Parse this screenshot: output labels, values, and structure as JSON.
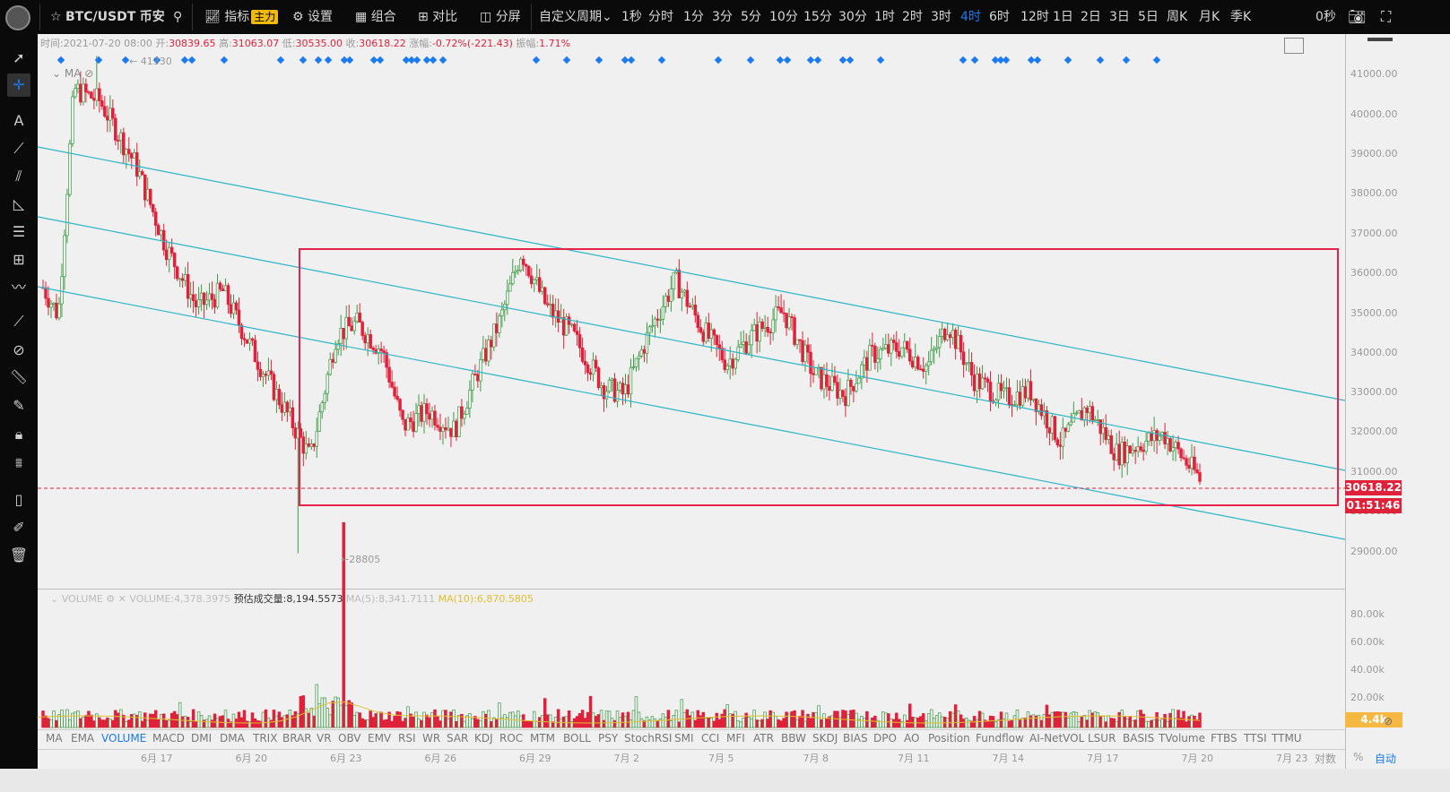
{
  "topbar": {
    "symbol": "BTC/USDT",
    "exchange": "币安",
    "indicators_label": "指标",
    "indicators_badge": "主力",
    "settings_label": "设置",
    "combo_label": "组合",
    "compare_label": "对比",
    "split_label": "分屏",
    "custom_period_label": "自定义周期",
    "periods": [
      "1秒",
      "分时",
      "1分",
      "3分",
      "5分",
      "10分",
      "15分",
      "30分",
      "1时",
      "2时",
      "3时",
      "4时",
      "6时",
      "12时",
      "1日",
      "2日",
      "3日",
      "5日",
      "周K",
      "月K",
      "季K"
    ],
    "active_period": "4时",
    "timer": "0秒"
  },
  "ohlc": {
    "time_label": "时间:",
    "time": "2021-07-20 08:00",
    "open_label": "开:",
    "open": "30839.65",
    "high_label": "高:",
    "high": "31063.07",
    "low_label": "低:",
    "low": "30535.00",
    "close_label": "收:",
    "close": "30618.22",
    "change_label": "涨幅:",
    "change": "-0.72%(-221.43)",
    "amp_label": "振幅:",
    "amp": "1.71%"
  },
  "ma_label": "MA",
  "high_marker": "41330",
  "low_marker": "←28805",
  "price_axis": [
    "41000.00",
    "40000.00",
    "39000.00",
    "38000.00",
    "37000.00",
    "36000.00",
    "35000.00",
    "34000.00",
    "33000.00",
    "32000.00",
    "31000.00",
    "30000.00",
    "29000.00"
  ],
  "current_price": "30618.22",
  "countdown": "01:51:46",
  "volume": {
    "title": "VOLUME",
    "value": "VOLUME:4,378.3975",
    "estimate": "预估成交量:8,194.5573",
    "ma5": "MA(5):8,341.7111",
    "ma10": "MA(10):6,870.5805",
    "axis": [
      "80.00k",
      "60.00k",
      "40.00k",
      "20.00k"
    ],
    "current": "4.4k"
  },
  "indicators": [
    "MA",
    "EMA",
    "VOLUME",
    "MACD",
    "DMI",
    "DMA",
    "TRIX",
    "BRAR",
    "VR",
    "OBV",
    "EMV",
    "RSI",
    "WR",
    "SAR",
    "KDJ",
    "ROC",
    "MTM",
    "BOLL",
    "PSY",
    "StochRSI",
    "SMI",
    "CCI",
    "MFI",
    "ATR",
    "BBW",
    "SKDJ",
    "BIAS",
    "DPO",
    "AO",
    "Position",
    "Fundflow",
    "AI-NetVOL",
    "LSUR",
    "BASIS",
    "TVolume",
    "FTBS",
    "TTSI",
    "TTMU"
  ],
  "active_indicator": "VOLUME",
  "dates": [
    "6月 17",
    "6月 20",
    "6月 23",
    "6月 26",
    "6月 29",
    "7月 2",
    "7月 5",
    "7月 8",
    "7月 11",
    "7月 14",
    "7月 17",
    "7月 20",
    "7月 23"
  ],
  "bottom": {
    "log_label": "对数",
    "pct_label": "%",
    "auto_label": "自动"
  },
  "colors": {
    "up": "#3c9c44",
    "down": "#e0213a",
    "channel": "#2bb5c7",
    "box": "#e8234a",
    "accent": "#1a7bf0"
  }
}
